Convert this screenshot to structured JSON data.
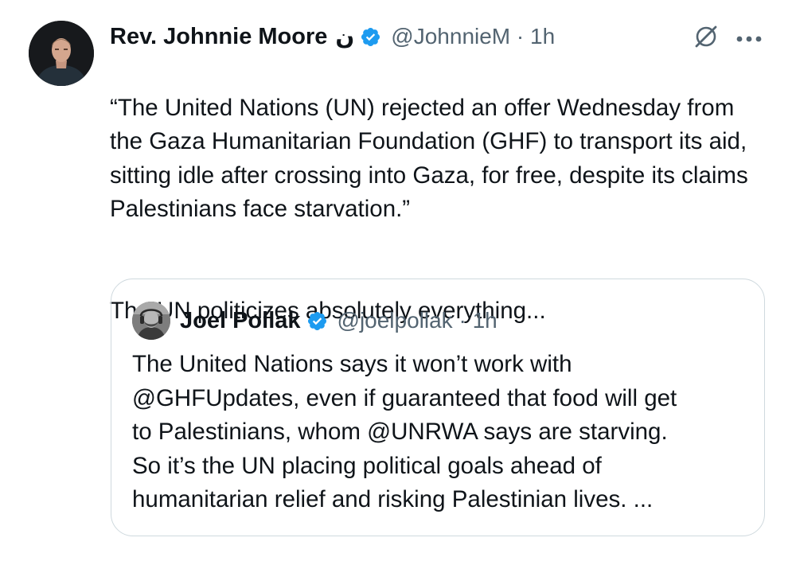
{
  "tweet": {
    "author": {
      "display_name": "Rev. Johnnie Moore",
      "name_glyph": "ن",
      "handle": "@JohnnieM",
      "separator": "·",
      "time": "1h",
      "verified": true
    },
    "icons": {
      "verified": "verified-badge-icon",
      "grok": "grok-icon",
      "more": "more-options-icon"
    },
    "body": {
      "paragraph_1": "“The United Nations (UN) rejected an offer Wednesday from the Gaza Humanitarian Foundation (GHF) to transport its aid, sitting idle after crossing into Gaza, for free, despite its claims Palestinians face starvation.”",
      "paragraph_2": "The UN politicizes absolutely everything..."
    },
    "quote": {
      "author": {
        "display_name": "Joel Pollak",
        "handle": "@joelpollak",
        "separator": "·",
        "time": "1h",
        "verified": true
      },
      "text_lines": [
        "The United Nations says it won’t work with",
        "@GHFUpdates, even if guaranteed that food will get",
        "to Palestinians, whom @UNRWA says are starving.",
        "So it’s the UN placing political goals ahead of",
        "humanitarian relief and risking Palestinian lives. ..."
      ]
    }
  },
  "colors": {
    "text_primary": "#0f1419",
    "text_secondary": "#536471",
    "verified_blue": "#1d9bf0",
    "quote_border": "#cfd9de"
  }
}
